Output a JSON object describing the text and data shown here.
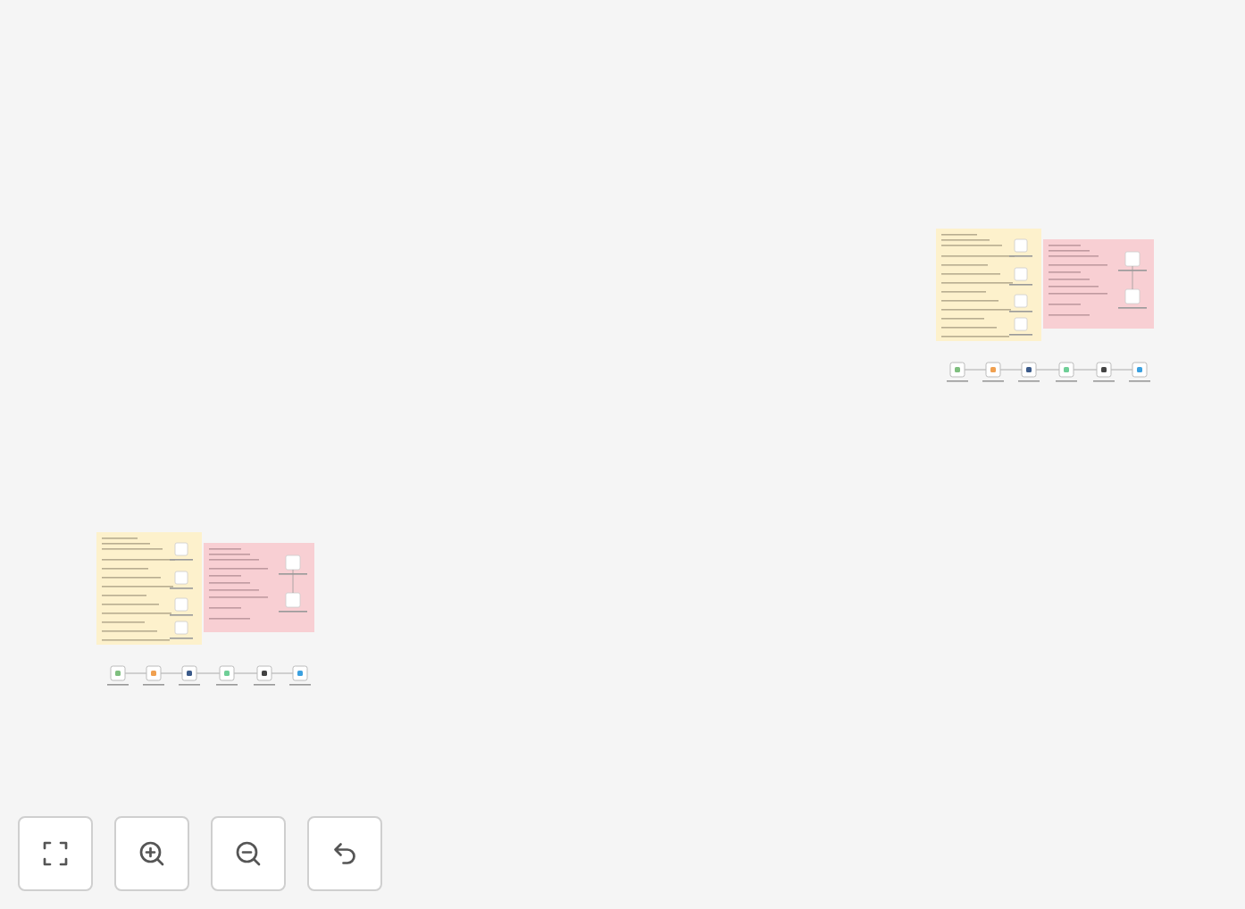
{
  "canvas": {
    "workflows": [
      {
        "kind": "workflow"
      },
      {
        "kind": "workflow"
      }
    ]
  },
  "controls": [
    {
      "kind": "fit"
    },
    {
      "kind": "zoom_in"
    },
    {
      "kind": "zoom_out"
    },
    {
      "kind": "undo"
    }
  ]
}
